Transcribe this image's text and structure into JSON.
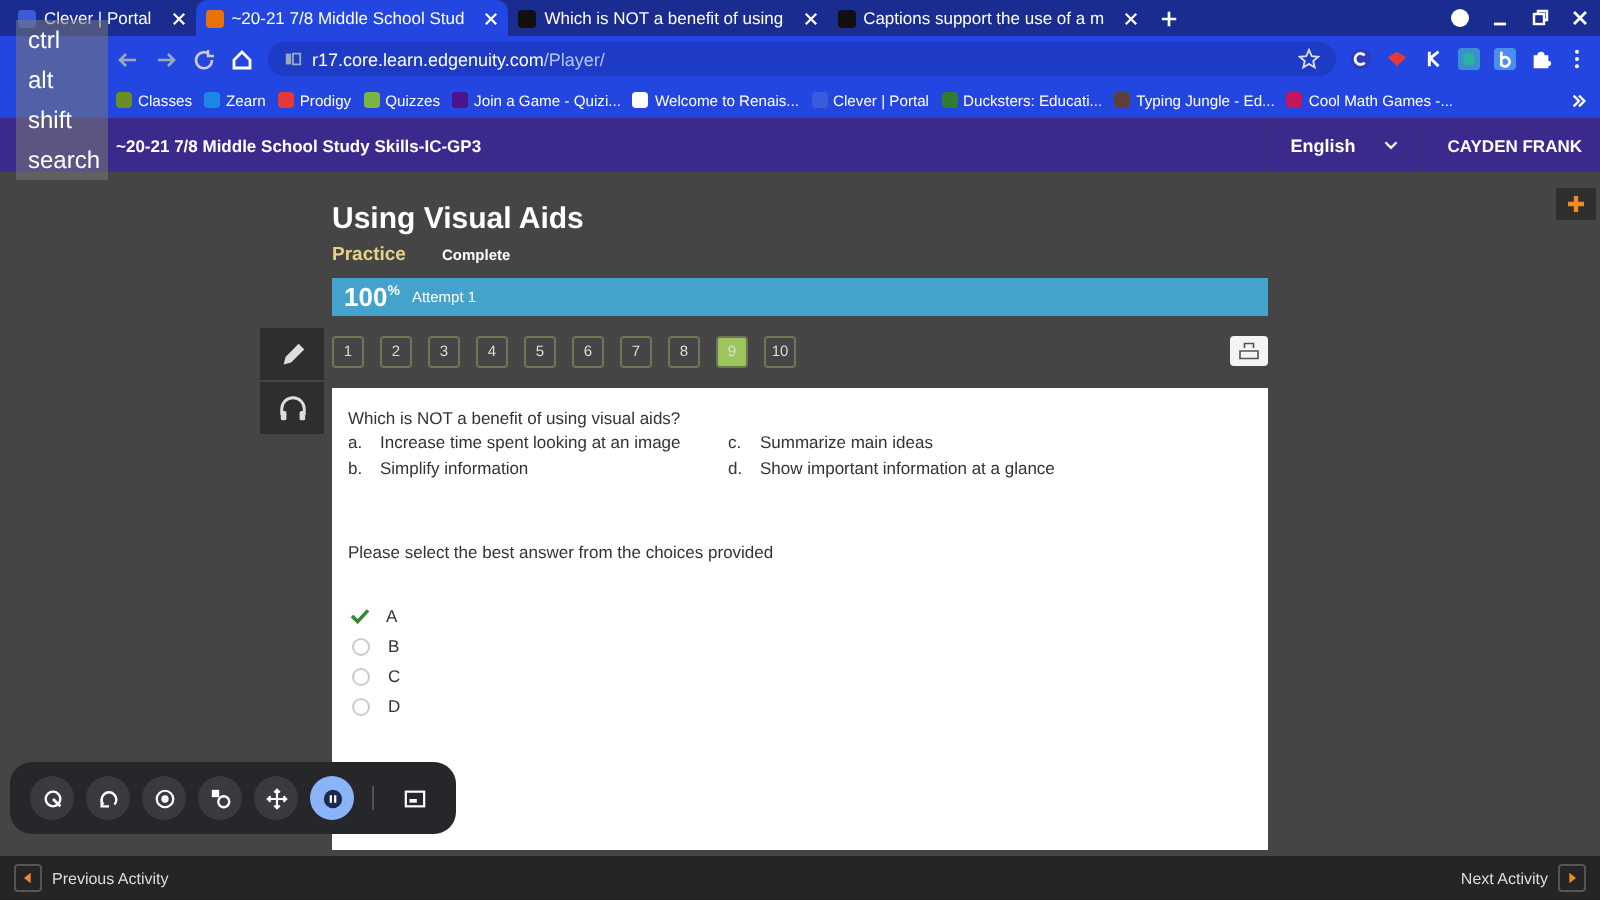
{
  "browser": {
    "tabs": [
      {
        "title": "Clever | Portal",
        "selected": false,
        "color": "#3b5bdb"
      },
      {
        "title": "~20-21 7/8 Middle School Stud",
        "selected": true,
        "color": "#e8710a"
      },
      {
        "title": "Which is NOT a benefit of using",
        "selected": false,
        "color": "#111111"
      },
      {
        "title": "Captions support the use of a m",
        "selected": false,
        "color": "#111111"
      }
    ],
    "url_host": "r17.core.learn.edgenuity.com",
    "url_path": "/Player/",
    "bookmarks": [
      {
        "label": "Classes",
        "color": "#6b8e23"
      },
      {
        "label": "Zearn",
        "color": "#1e88e5"
      },
      {
        "label": "Prodigy",
        "color": "#e53935"
      },
      {
        "label": "Quizzes",
        "color": "#7cb342"
      },
      {
        "label": "Join a Game - Quizi...",
        "color": "#4a148c"
      },
      {
        "label": "Welcome to Renais...",
        "color": "#ffffff"
      },
      {
        "label": "Clever | Portal",
        "color": "#3b5bdb"
      },
      {
        "label": "Ducksters: Educati...",
        "color": "#2e7d32"
      },
      {
        "label": "Typing Jungle - Ed...",
        "color": "#5d4037"
      },
      {
        "label": "Cool Math Games -...",
        "color": "#c2185b"
      }
    ]
  },
  "key_overlay": {
    "keys": [
      "ctrl",
      "alt",
      "shift",
      "search"
    ]
  },
  "course_header": {
    "title": "~20-21 7/8 Middle School Study Skills-IC-GP3",
    "language": "English",
    "user": "CAYDEN FRANK"
  },
  "lesson": {
    "title": "Using Visual Aids",
    "tabs": [
      {
        "label": "Practice",
        "selected": true
      },
      {
        "label": "Complete",
        "selected": false
      }
    ],
    "score": "100",
    "score_unit": "%",
    "attempt": "Attempt 1",
    "questions": [
      {
        "label": "1",
        "selected": false
      },
      {
        "label": "2",
        "selected": false
      },
      {
        "label": "3",
        "selected": false
      },
      {
        "label": "4",
        "selected": false
      },
      {
        "label": "5",
        "selected": false
      },
      {
        "label": "6",
        "selected": false
      },
      {
        "label": "7",
        "selected": false
      },
      {
        "label": "8",
        "selected": false
      },
      {
        "label": "9",
        "selected": true
      },
      {
        "label": "10",
        "selected": false
      }
    ],
    "question": "Which is NOT a benefit of using visual aids?",
    "options": [
      {
        "letter": "a.",
        "text": "Increase time spent looking at an image"
      },
      {
        "letter": "c.",
        "text": "Summarize main ideas"
      },
      {
        "letter": "b.",
        "text": "Simplify information"
      },
      {
        "letter": "d.",
        "text": "Show important information at a glance"
      }
    ],
    "instruction": "Please select the best answer from the choices provided",
    "answers": [
      {
        "label": "A",
        "selected": true
      },
      {
        "label": "B",
        "selected": false
      },
      {
        "label": "C",
        "selected": false
      },
      {
        "label": "D",
        "selected": false
      }
    ]
  },
  "capture_toolbar": {
    "buttons": [
      {
        "kind": "region",
        "active": false
      },
      {
        "kind": "rotate",
        "active": false
      },
      {
        "kind": "target",
        "active": false
      },
      {
        "kind": "record",
        "active": false
      },
      {
        "kind": "move",
        "active": false
      },
      {
        "kind": "pause",
        "active": true
      },
      {
        "kind": "window",
        "active": false
      }
    ]
  },
  "footer": {
    "previous": "Previous Activity",
    "next": "Next Activity"
  }
}
